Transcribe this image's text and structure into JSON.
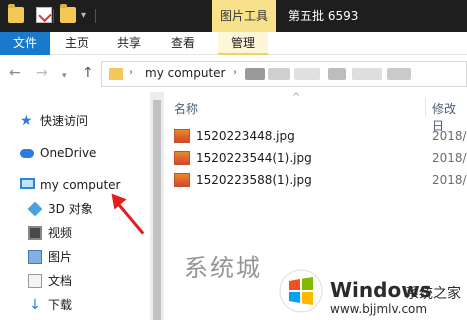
{
  "titlebar": {
    "context_tab": "图片工具",
    "window_title": "第五批 6593",
    "dropdown_glyph": "▾"
  },
  "ribbon": {
    "tabs": [
      "文件",
      "主页",
      "共享",
      "查看",
      "管理"
    ]
  },
  "nav": {
    "back_glyph": "←",
    "forward_glyph": "→",
    "recent_glyph": "▾",
    "up_glyph": "↑"
  },
  "address": {
    "path": [
      "my computer"
    ],
    "separator_glyph": "›"
  },
  "sidebar": {
    "items": [
      {
        "label": "快速访问",
        "icon": "star-icon"
      },
      {
        "label": "OneDrive",
        "icon": "cloud-icon"
      },
      {
        "label": "my computer",
        "icon": "computer-icon"
      },
      {
        "label": "3D 对象",
        "icon": "cube-icon"
      },
      {
        "label": "视频",
        "icon": "video-icon"
      },
      {
        "label": "图片",
        "icon": "pictures-icon"
      },
      {
        "label": "文档",
        "icon": "document-icon"
      },
      {
        "label": "下载",
        "icon": "download-icon"
      }
    ]
  },
  "filelist": {
    "sort_caret": "^",
    "columns": {
      "name": "名称",
      "date": "修改日"
    },
    "files": [
      {
        "name": "1520223448.jpg",
        "date": "2018/"
      },
      {
        "name": "1520223544(1).jpg",
        "date": "2018/"
      },
      {
        "name": "1520223588(1).jpg",
        "date": "2018/"
      }
    ]
  },
  "watermark": {
    "glyph_text": "系统城",
    "brand": "Windows",
    "brand_suffix": "系统之家",
    "url": "www.bjjmlv.com"
  },
  "colors": {
    "titlebar": "#1e1e1e",
    "file_tab": "#1979ca",
    "context_tab": "#f7e28b",
    "annotation_arrow": "#e02020"
  }
}
